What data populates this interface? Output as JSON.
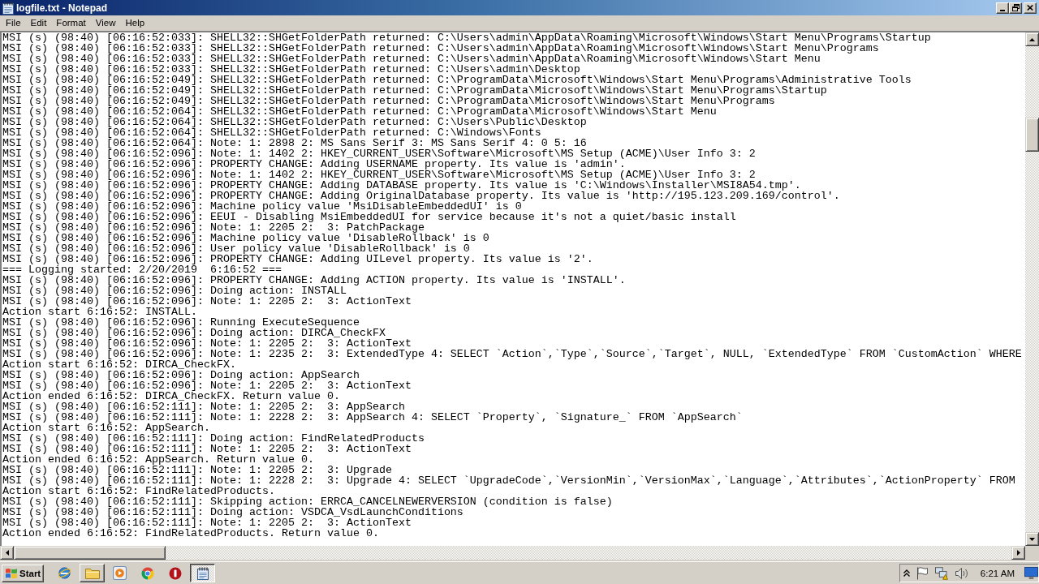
{
  "window": {
    "title": "logfile.txt - Notepad"
  },
  "menu": [
    "File",
    "Edit",
    "Format",
    "View",
    "Help"
  ],
  "document": {
    "lines": [
      "MSI (s) (98:40) [06:16:52:033]: SHELL32::SHGetFolderPath returned: C:\\Users\\admin\\AppData\\Roaming\\Microsoft\\Windows\\Start Menu\\Programs\\Startup",
      "MSI (s) (98:40) [06:16:52:033]: SHELL32::SHGetFolderPath returned: C:\\Users\\admin\\AppData\\Roaming\\Microsoft\\Windows\\Start Menu\\Programs",
      "MSI (s) (98:40) [06:16:52:033]: SHELL32::SHGetFolderPath returned: C:\\Users\\admin\\AppData\\Roaming\\Microsoft\\Windows\\Start Menu",
      "MSI (s) (98:40) [06:16:52:033]: SHELL32::SHGetFolderPath returned: C:\\Users\\admin\\Desktop",
      "MSI (s) (98:40) [06:16:52:049]: SHELL32::SHGetFolderPath returned: C:\\ProgramData\\Microsoft\\Windows\\Start Menu\\Programs\\Administrative Tools",
      "MSI (s) (98:40) [06:16:52:049]: SHELL32::SHGetFolderPath returned: C:\\ProgramData\\Microsoft\\Windows\\Start Menu\\Programs\\Startup",
      "MSI (s) (98:40) [06:16:52:049]: SHELL32::SHGetFolderPath returned: C:\\ProgramData\\Microsoft\\Windows\\Start Menu\\Programs",
      "MSI (s) (98:40) [06:16:52:064]: SHELL32::SHGetFolderPath returned: C:\\ProgramData\\Microsoft\\Windows\\Start Menu",
      "MSI (s) (98:40) [06:16:52:064]: SHELL32::SHGetFolderPath returned: C:\\Users\\Public\\Desktop",
      "MSI (s) (98:40) [06:16:52:064]: SHELL32::SHGetFolderPath returned: C:\\Windows\\Fonts",
      "MSI (s) (98:40) [06:16:52:064]: Note: 1: 2898 2: MS Sans Serif 3: MS Sans Serif 4: 0 5: 16",
      "MSI (s) (98:40) [06:16:52:096]: Note: 1: 1402 2: HKEY_CURRENT_USER\\Software\\Microsoft\\MS Setup (ACME)\\User Info 3: 2",
      "MSI (s) (98:40) [06:16:52:096]: PROPERTY CHANGE: Adding USERNAME property. Its value is 'admin'.",
      "MSI (s) (98:40) [06:16:52:096]: Note: 1: 1402 2: HKEY_CURRENT_USER\\Software\\Microsoft\\MS Setup (ACME)\\User Info 3: 2",
      "MSI (s) (98:40) [06:16:52:096]: PROPERTY CHANGE: Adding DATABASE property. Its value is 'C:\\Windows\\Installer\\MSI8A54.tmp'.",
      "MSI (s) (98:40) [06:16:52:096]: PROPERTY CHANGE: Adding OriginalDatabase property. Its value is 'http://195.123.209.169/control'.",
      "MSI (s) (98:40) [06:16:52:096]: Machine policy value 'MsiDisableEmbeddedUI' is 0",
      "MSI (s) (98:40) [06:16:52:096]: EEUI - Disabling MsiEmbeddedUI for service because it's not a quiet/basic install",
      "MSI (s) (98:40) [06:16:52:096]: Note: 1: 2205 2:  3: PatchPackage",
      "MSI (s) (98:40) [06:16:52:096]: Machine policy value 'DisableRollback' is 0",
      "MSI (s) (98:40) [06:16:52:096]: User policy value 'DisableRollback' is 0",
      "MSI (s) (98:40) [06:16:52:096]: PROPERTY CHANGE: Adding UILevel property. Its value is '2'.",
      "=== Logging started: 2/20/2019  6:16:52 ===",
      "MSI (s) (98:40) [06:16:52:096]: PROPERTY CHANGE: Adding ACTION property. Its value is 'INSTALL'.",
      "MSI (s) (98:40) [06:16:52:096]: Doing action: INSTALL",
      "MSI (s) (98:40) [06:16:52:096]: Note: 1: 2205 2:  3: ActionText",
      "Action start 6:16:52: INSTALL.",
      "MSI (s) (98:40) [06:16:52:096]: Running ExecuteSequence",
      "MSI (s) (98:40) [06:16:52:096]: Doing action: DIRCA_CheckFX",
      "MSI (s) (98:40) [06:16:52:096]: Note: 1: 2205 2:  3: ActionText",
      "MSI (s) (98:40) [06:16:52:096]: Note: 1: 2235 2:  3: ExtendedType 4: SELECT `Action`,`Type`,`Source`,`Target`, NULL, `ExtendedType` FROM `CustomAction` WHERE",
      "Action start 6:16:52: DIRCA_CheckFX.",
      "MSI (s) (98:40) [06:16:52:096]: Doing action: AppSearch",
      "MSI (s) (98:40) [06:16:52:096]: Note: 1: 2205 2:  3: ActionText",
      "Action ended 6:16:52: DIRCA_CheckFX. Return value 0.",
      "MSI (s) (98:40) [06:16:52:111]: Note: 1: 2205 2:  3: AppSearch",
      "MSI (s) (98:40) [06:16:52:111]: Note: 1: 2228 2:  3: AppSearch 4: SELECT `Property`, `Signature_` FROM `AppSearch`",
      "Action start 6:16:52: AppSearch.",
      "MSI (s) (98:40) [06:16:52:111]: Doing action: FindRelatedProducts",
      "MSI (s) (98:40) [06:16:52:111]: Note: 1: 2205 2:  3: ActionText",
      "Action ended 6:16:52: AppSearch. Return value 0.",
      "MSI (s) (98:40) [06:16:52:111]: Note: 1: 2205 2:  3: Upgrade",
      "MSI (s) (98:40) [06:16:52:111]: Note: 1: 2228 2:  3: Upgrade 4: SELECT `UpgradeCode`,`VersionMin`,`VersionMax`,`Language`,`Attributes`,`ActionProperty` FROM",
      "Action start 6:16:52: FindRelatedProducts.",
      "MSI (s) (98:40) [06:16:52:111]: Skipping action: ERRCA_CANCELNEWERVERSION (condition is false)",
      "MSI (s) (98:40) [06:16:52:111]: Doing action: VSDCA_VsdLaunchConditions",
      "MSI (s) (98:40) [06:16:52:111]: Note: 1: 2205 2:  3: ActionText",
      "Action ended 6:16:52: FindRelatedProducts. Return value 0."
    ]
  },
  "taskbar": {
    "start": "Start",
    "items": [
      {
        "kind": "globe",
        "running": false,
        "selected": false
      },
      {
        "kind": "folder",
        "running": true,
        "selected": false
      },
      {
        "kind": "player",
        "running": false,
        "selected": false
      },
      {
        "kind": "browser",
        "running": false,
        "selected": false
      },
      {
        "kind": "stop",
        "running": false,
        "selected": false
      },
      {
        "kind": "notepad",
        "running": true,
        "selected": true
      }
    ],
    "clock": "6:21 AM"
  }
}
